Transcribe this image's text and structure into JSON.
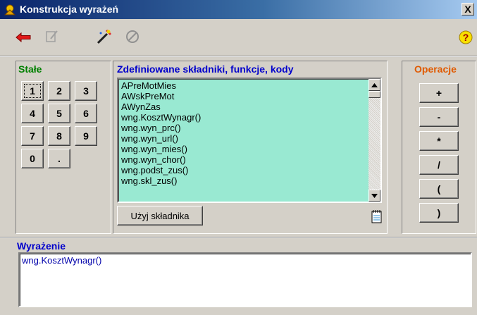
{
  "window": {
    "title": "Konstrukcja wyrażeń",
    "close_label": "X"
  },
  "toolbar": {
    "icons": [
      "back-arrow-icon",
      "disabled-pen-icon",
      "eraser-wand-icon",
      "cancel-icon",
      "help-icon"
    ],
    "help_label": "?"
  },
  "constants": {
    "heading": "Stałe",
    "keys": [
      "1",
      "2",
      "3",
      "4",
      "5",
      "6",
      "7",
      "8",
      "9",
      "0",
      "."
    ]
  },
  "components": {
    "heading": "Zdefiniowane składniki, funkcje, kody",
    "items": [
      "APreMotMies",
      "AWskPreMot",
      "AWynZas",
      "wng.KosztWynagr()",
      "wng.wyn_prc()",
      "wng.wyn_url()",
      "wng.wyn_mies()",
      "wng.wyn_chor()",
      "wng.podst_zus()",
      "wng.skl_zus()"
    ],
    "use_button": "Użyj składnika"
  },
  "operations": {
    "heading": "Operacje",
    "items": [
      "+",
      "-",
      "*",
      "/",
      "(",
      ")"
    ]
  },
  "expression": {
    "heading": "Wyrażenie",
    "value": "wng.KosztWynagr()"
  },
  "colors": {
    "list_background": "#99e9d2",
    "heading_green": "#008000",
    "heading_blue": "#0000cc",
    "heading_orange": "#e05a00"
  }
}
